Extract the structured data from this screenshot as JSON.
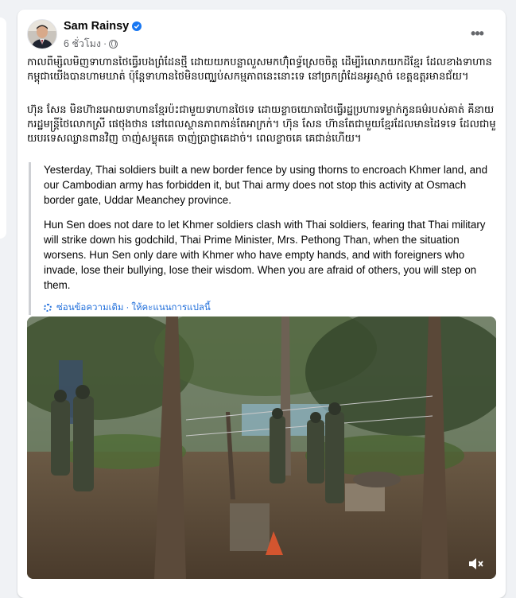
{
  "post": {
    "author": "Sam Rainsy",
    "timestamp": "6 ชั่วโมง",
    "more_label": "•••",
    "original_paragraph_1": "កាលពីម្សិលមិញទាហានថៃធ្វើរបងព្រំដែនថ្មី ដោយយកបន្លាលួសមកហ៊ុំពទ្ធ័ស្រេចចិត្ត ដើម្បីរំលោភយកដីខ្មែរ ដែលខាងទាហានកម្ពុជាយើងបានហាមឃាត់ ប៉ុន្តែទាហានថៃមិនបញ្ឈប់សកម្មភាពនេះនោះទេ នៅច្រកព្រំដែនអូរស្មាច់ ខេត្តឧត្តរមានជ័យ។",
    "original_paragraph_2": "ហ៊ុន សែន មិនហ៊ានអោយទាហានខ្មែរប៉ះជាមួយទាហានថៃទេ ដោយខ្លាចយោធាថៃធ្វើរដ្ឋប្រហារទម្លាក់កូនធម៌របស់គាត់ គឺនាយករដ្ឋមន្ត្រីថៃលោកស្រី ផេថុងថាន នៅពេលស្ថានភាពកាន់តែអាក្រក់។ ហ៊ុន សែន ហ៊ានតែជាមួយខ្មែរដែលមានដៃទទេ ដែលជាមួយបរទេសឈ្លានពានវិញ ចាញ់សម្លុតគេ ចាញ់ប្រាជ្ញាគេដាច់។ ពេលខ្លាចគេ គេជាន់ហើយ។",
    "translation_paragraph_1": "Yesterday, Thai soldiers built a new border fence by using thorns to encroach Khmer land, and our Cambodian army has forbidden it, but Thai army does not stop this activity at Osmach border gate, Uddar Meanchey province.",
    "translation_paragraph_2": "Hun Sen does not dare to let Khmer soldiers clash with Thai soldiers, fearing that Thai military will strike down his godchild, Thai Prime Minister, Mrs. Pethong Than, when the situation worsens. Hun Sen only dare with Khmer who have empty hands, and with foreigners who invade, lose their bullying, lose their wisdom. When you are afraid of others, you will step on them.",
    "hide_original_label": "ซ่อนข้อความเดิม",
    "separator": "·",
    "rate_translation_label": "ให้คะแนนการแปลนี้"
  },
  "icons": {
    "verified": "verified-badge-icon",
    "audience": "globe-icon",
    "settings": "gear-icon",
    "volume": "volume-muted-icon"
  },
  "colors": {
    "link": "#216fdb",
    "verified": "#1877f2",
    "secondary_text": "#65676b"
  }
}
